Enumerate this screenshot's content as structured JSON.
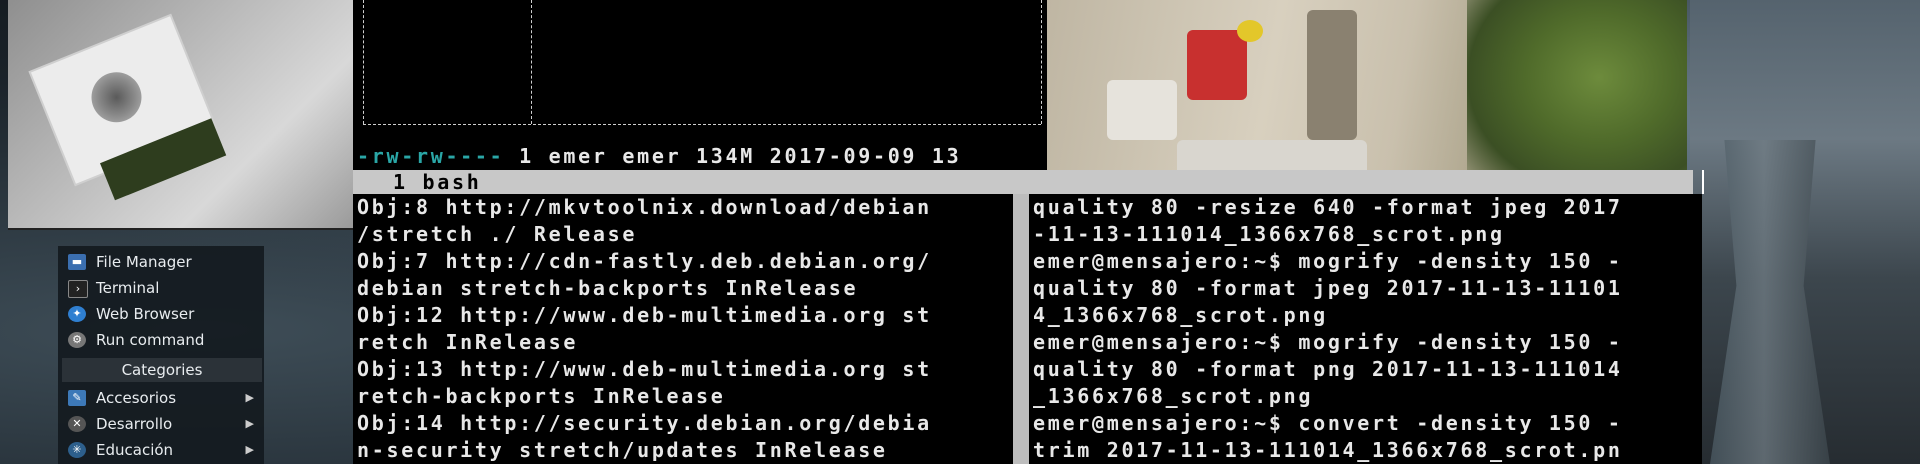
{
  "menu": {
    "items": [
      {
        "label": "File Manager",
        "icon": "folder-icon"
      },
      {
        "label": "Terminal",
        "icon": "terminal-icon"
      },
      {
        "label": "Web Browser",
        "icon": "globe-icon"
      },
      {
        "label": "Run command",
        "icon": "gears-icon"
      }
    ],
    "categories_label": "Categories",
    "categories": [
      {
        "label": "Accesorios",
        "icon": "accessories-icon"
      },
      {
        "label": "Desarrollo",
        "icon": "development-icon"
      },
      {
        "label": "Educación",
        "icon": "education-icon"
      }
    ]
  },
  "terminal": {
    "ls_line": {
      "perms": "-rw-rw----",
      "rest": " 1 emer emer 134M 2017-09-09 13"
    },
    "tab": {
      "label": "1 bash"
    },
    "left_pane_lines": [
      "Obj:8 http://mkvtoolnix.download/debian",
      "/stretch ./ Release",
      "Obj:7 http://cdn-fastly.deb.debian.org/",
      "debian stretch-backports InRelease",
      "Obj:12 http://www.deb-multimedia.org st",
      "retch InRelease",
      "Obj:13 http://www.deb-multimedia.org st",
      "retch-backports InRelease",
      "Obj:14 http://security.debian.org/debia",
      "n-security stretch/updates InRelease"
    ],
    "right_pane_lines": [
      "quality 80 -resize 640 -format jpeg 2017",
      "-11-13-111014_1366x768_scrot.png",
      "emer@mensajero:~$ mogrify -density 150 -",
      "quality 80 -format jpeg 2017-11-13-11101",
      "4_1366x768_scrot.png",
      "emer@mensajero:~$ mogrify -density 150 -",
      "quality 80 -format png 2017-11-13-111014",
      "_1366x768_scrot.png",
      "emer@mensajero:~$ convert -density 150 -",
      "trim 2017-11-13-111014_1366x768_scrot.pn"
    ]
  },
  "colors": {
    "terminal_bg": "#000000",
    "terminal_fg": "#e8e8e8",
    "perm_color": "#2aa6a6",
    "tabbar_bg": "#c8c8c8"
  }
}
